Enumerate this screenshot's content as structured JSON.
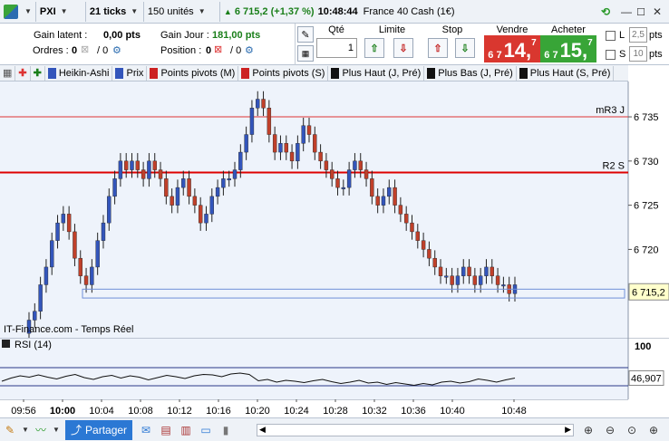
{
  "titlebar": {
    "market": "PXI",
    "interval": "21 ticks",
    "quantity_units": "150 unités",
    "last_price": "6 715,2 (+1,37 %)",
    "time": "10:48:44",
    "instrument": "France 40 Cash (1€)"
  },
  "positions": {
    "gain_latent_label": "Gain latent :",
    "gain_latent_value": "0,00 pts",
    "gain_jour_label": "Gain Jour :",
    "gain_jour_value": "181,00 pts",
    "ordres_label": "Ordres :",
    "ordres_value": "0",
    "ordres_alt": "/ 0",
    "position_label": "Position :",
    "position_value": "0",
    "position_alt": "/ 0"
  },
  "order": {
    "qty_label": "Qté",
    "qty_value": "1",
    "limit_label": "Limite",
    "stop_label": "Stop",
    "sell_label": "Vendre",
    "buy_label": "Acheter",
    "sell_prefix": "6 7",
    "sell_main": "14,",
    "sell_sup": "7",
    "buy_prefix": "6 7",
    "buy_main": "15,",
    "buy_sup": "7",
    "l_label": "L",
    "l_value": "2,5",
    "s_label": "S",
    "s_value": "10",
    "pts": "pts",
    "colors": {
      "sell": "#d9372f",
      "buy": "#38a537"
    }
  },
  "indicators": [
    {
      "label": "Heikin-Ashi",
      "color": "#3355bb"
    },
    {
      "label": "Prix",
      "color": "#3355bb"
    },
    {
      "label": "Points pivots (M)",
      "color": "#cc2222"
    },
    {
      "label": "Points pivots (S)",
      "color": "#cc2222"
    },
    {
      "label": "Plus Haut (J, Pré)",
      "color": "#111111"
    },
    {
      "label": "Plus Bas (J, Pré)",
      "color": "#111111"
    },
    {
      "label": "Plus Haut (S, Pré)",
      "color": "#111111"
    }
  ],
  "chart_data": {
    "type": "candlestick",
    "ylim": [
      6710,
      6739
    ],
    "y_ticks": [
      "6 735",
      "6 730",
      "6 725",
      "6 720"
    ],
    "y_tick_values": [
      6735,
      6730,
      6725,
      6720
    ],
    "x_ticks": [
      "09:56",
      "10:00",
      "10:04",
      "10:08",
      "10:12",
      "10:16",
      "10:20",
      "10:24",
      "10:28",
      "10:32",
      "10:36",
      "10:40",
      "10:48"
    ],
    "levels": [
      {
        "name": "mR3 J",
        "value": 6735.0,
        "color": "#d33"
      },
      {
        "name": "R2 S",
        "value": 6728.7,
        "color": "#d00"
      }
    ],
    "last_value": 6715.2,
    "last_label": "6 715,2",
    "source_label": "IT-Finance.com - Temps Réel",
    "closes": [
      6712,
      6713,
      6716,
      6718,
      6721,
      6723,
      6724,
      6722,
      6719,
      6717,
      6716,
      6718,
      6721,
      6723,
      6726,
      6728,
      6730,
      6729,
      6730,
      6729,
      6728,
      6730,
      6729,
      6728,
      6726,
      6725,
      6727,
      6728,
      6726,
      6725,
      6723,
      6724,
      6726,
      6727,
      6728,
      6728,
      6729,
      6731,
      6733,
      6736,
      6737,
      6736,
      6733,
      6731,
      6732,
      6731,
      6730,
      6732,
      6734,
      6733,
      6731,
      6730,
      6729,
      6728,
      6727,
      6727,
      6729,
      6730,
      6729,
      6728,
      6726,
      6725,
      6726,
      6727,
      6725,
      6724,
      6723,
      6722,
      6721,
      6720,
      6719,
      6718,
      6717,
      6717,
      6716,
      6717,
      6718,
      6717,
      6716,
      6717,
      6718,
      6717,
      6716,
      6716,
      6715,
      6716
    ],
    "rsi": {
      "label": "RSI (14)",
      "ylim": [
        0,
        100
      ],
      "top_tick": "100",
      "last_label": "46,907",
      "values": [
        40,
        47,
        52,
        49,
        54,
        49,
        45,
        51,
        55,
        48,
        44,
        50,
        53,
        47,
        52,
        49,
        43,
        48,
        53,
        50,
        46,
        52,
        55,
        54,
        50,
        56,
        58,
        55,
        41,
        44,
        38,
        42,
        40,
        37,
        41,
        44,
        39,
        35,
        38,
        42,
        36,
        38,
        33,
        37,
        34,
        31,
        35,
        32,
        38,
        40,
        36,
        39,
        45,
        42,
        38,
        43,
        47
      ]
    }
  },
  "bottombar": {
    "share_label": "Partager"
  }
}
